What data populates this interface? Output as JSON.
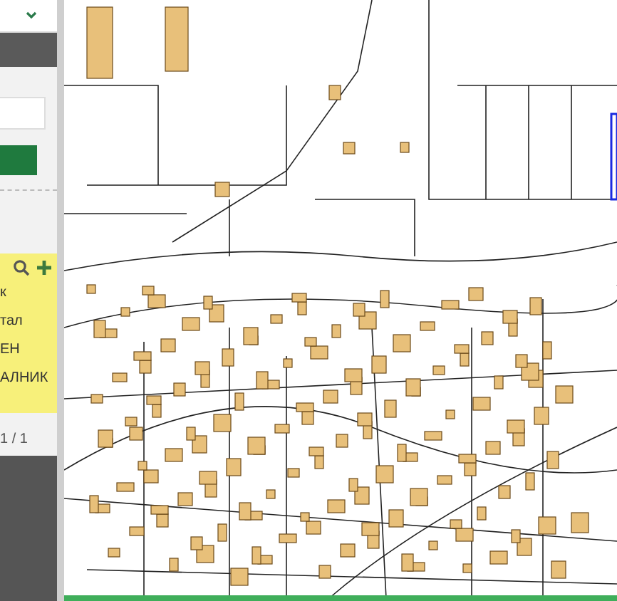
{
  "sidebar": {
    "results": [
      {
        "label": "к"
      },
      {
        "label": "тал"
      },
      {
        "label": "ЕН"
      },
      {
        "label": "АЛНИК"
      }
    ],
    "pager": "1 / 1"
  }
}
